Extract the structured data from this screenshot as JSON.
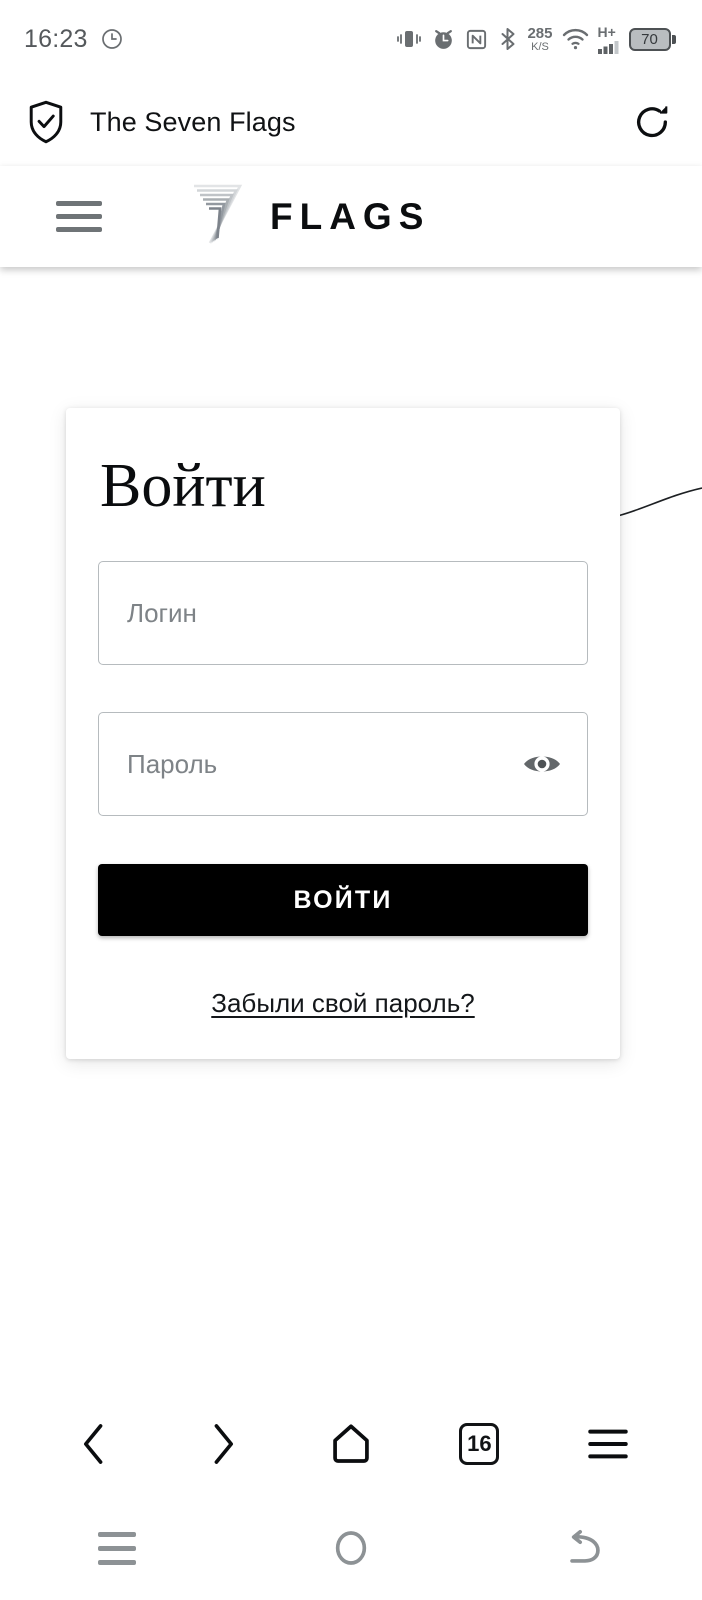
{
  "status_bar": {
    "time": "16:23",
    "clock_icon": "alarm-history-icon",
    "icons": [
      {
        "name": "vibrate-icon"
      },
      {
        "name": "alarm-clock-icon"
      },
      {
        "name": "nfc-icon"
      },
      {
        "name": "bluetooth-icon"
      }
    ],
    "network_speed": {
      "value": "285",
      "unit": "K/S"
    },
    "wifi_icon": "wifi-icon",
    "signal": {
      "label": "H+",
      "icon": "cellular-signal-icon"
    },
    "battery": {
      "level": "70"
    }
  },
  "browser_bar": {
    "security_icon": "shield-check-icon",
    "title": "The Seven Flags",
    "reload_icon": "reload-icon"
  },
  "site_header": {
    "menu_icon": "hamburger-menu-icon",
    "logo_mark": "seven-logo-icon",
    "logo_word": "FLAGS"
  },
  "login_card": {
    "title": "Войти",
    "login_field": {
      "placeholder": "Логин",
      "value": ""
    },
    "password_field": {
      "placeholder": "Пароль",
      "value": "",
      "toggle_icon": "eye-icon"
    },
    "submit_label": "ВОЙТИ",
    "forgot_label": "Забыли свой пароль?"
  },
  "browser_toolbar": {
    "back_icon": "chevron-left-icon",
    "forward_icon": "chevron-right-icon",
    "home_icon": "home-icon",
    "tab_count": "16",
    "menu_icon": "browser-menu-icon"
  },
  "system_nav": {
    "recents_icon": "recents-icon",
    "home_icon": "home-circle-icon",
    "back_icon": "back-arrow-icon"
  },
  "colors": {
    "accent": "#000000",
    "page_bg": "#ffffff",
    "border": "#b6bbbe",
    "placeholder": "#7e8387",
    "status_text": "#55595c"
  }
}
